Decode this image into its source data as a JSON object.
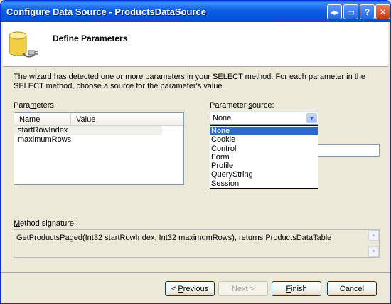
{
  "window": {
    "title": "Configure Data Source - ProductsDataSource",
    "controls": {
      "help": "?",
      "close": "✕",
      "maximize": "▭",
      "back": "◂▸"
    }
  },
  "header": {
    "title": "Define Parameters"
  },
  "description": "The wizard has detected one or more parameters in your SELECT method. For each parameter in the SELECT method, choose a source for the parameter's value.",
  "parameters": {
    "label_prefix": "Para",
    "label_accel": "m",
    "label_suffix": "eters:",
    "columns": [
      "Name",
      "Value"
    ],
    "rows": [
      {
        "name": "startRowIndex",
        "value": "",
        "selected": true
      },
      {
        "name": "maximumRows",
        "value": "",
        "selected": false
      }
    ]
  },
  "parameter_source": {
    "label_prefix": "Parameter ",
    "label_accel": "s",
    "label_suffix": "ource:",
    "selected": "None",
    "options": [
      "None",
      "Cookie",
      "Control",
      "Form",
      "Profile",
      "QueryString",
      "Session"
    ]
  },
  "method_signature": {
    "label_accel": "M",
    "label_suffix": "ethod signature:",
    "text": "GetProductsPaged(Int32 startRowIndex, Int32 maximumRows), returns ProductsDataTable"
  },
  "buttons": {
    "previous": {
      "prefix": "< ",
      "accel": "P",
      "suffix": "revious"
    },
    "next": "Next >",
    "finish": {
      "accel": "F",
      "suffix": "inish"
    },
    "cancel": "Cancel"
  }
}
